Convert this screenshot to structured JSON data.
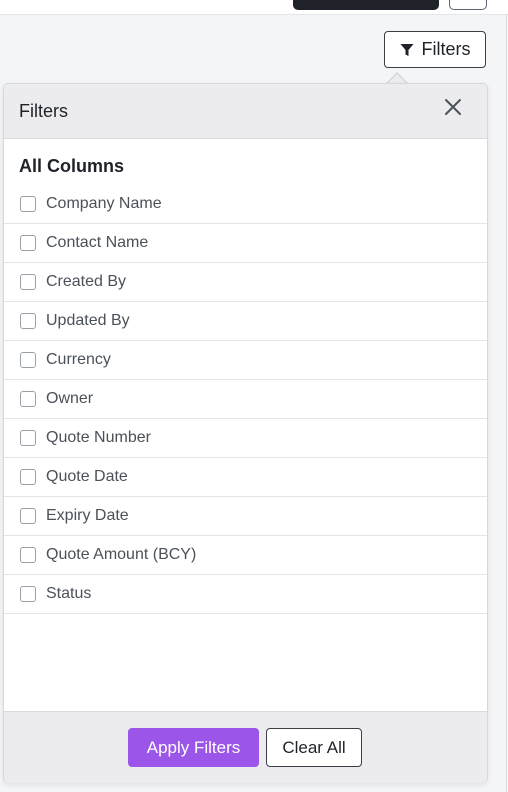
{
  "toolbar": {
    "filters_button_label": "Filters",
    "filters_icon": "funnel-icon"
  },
  "filters_panel": {
    "title": "Filters",
    "close_icon": "close-icon",
    "section_title": "All Columns",
    "columns": [
      {
        "label": "Company Name",
        "checked": false
      },
      {
        "label": "Contact Name",
        "checked": false
      },
      {
        "label": "Created By",
        "checked": false
      },
      {
        "label": "Updated By",
        "checked": false
      },
      {
        "label": "Currency",
        "checked": false
      },
      {
        "label": "Owner",
        "checked": false
      },
      {
        "label": "Quote Number",
        "checked": false
      },
      {
        "label": "Quote Date",
        "checked": false
      },
      {
        "label": "Expiry Date",
        "checked": false
      },
      {
        "label": "Quote Amount (BCY)",
        "checked": false
      },
      {
        "label": "Status",
        "checked": false
      }
    ],
    "apply_label": "Apply Filters",
    "clear_label": "Clear All"
  },
  "colors": {
    "accent": "#9b55e8",
    "header_bg": "#ececee",
    "page_bg": "#f4f5f7"
  }
}
